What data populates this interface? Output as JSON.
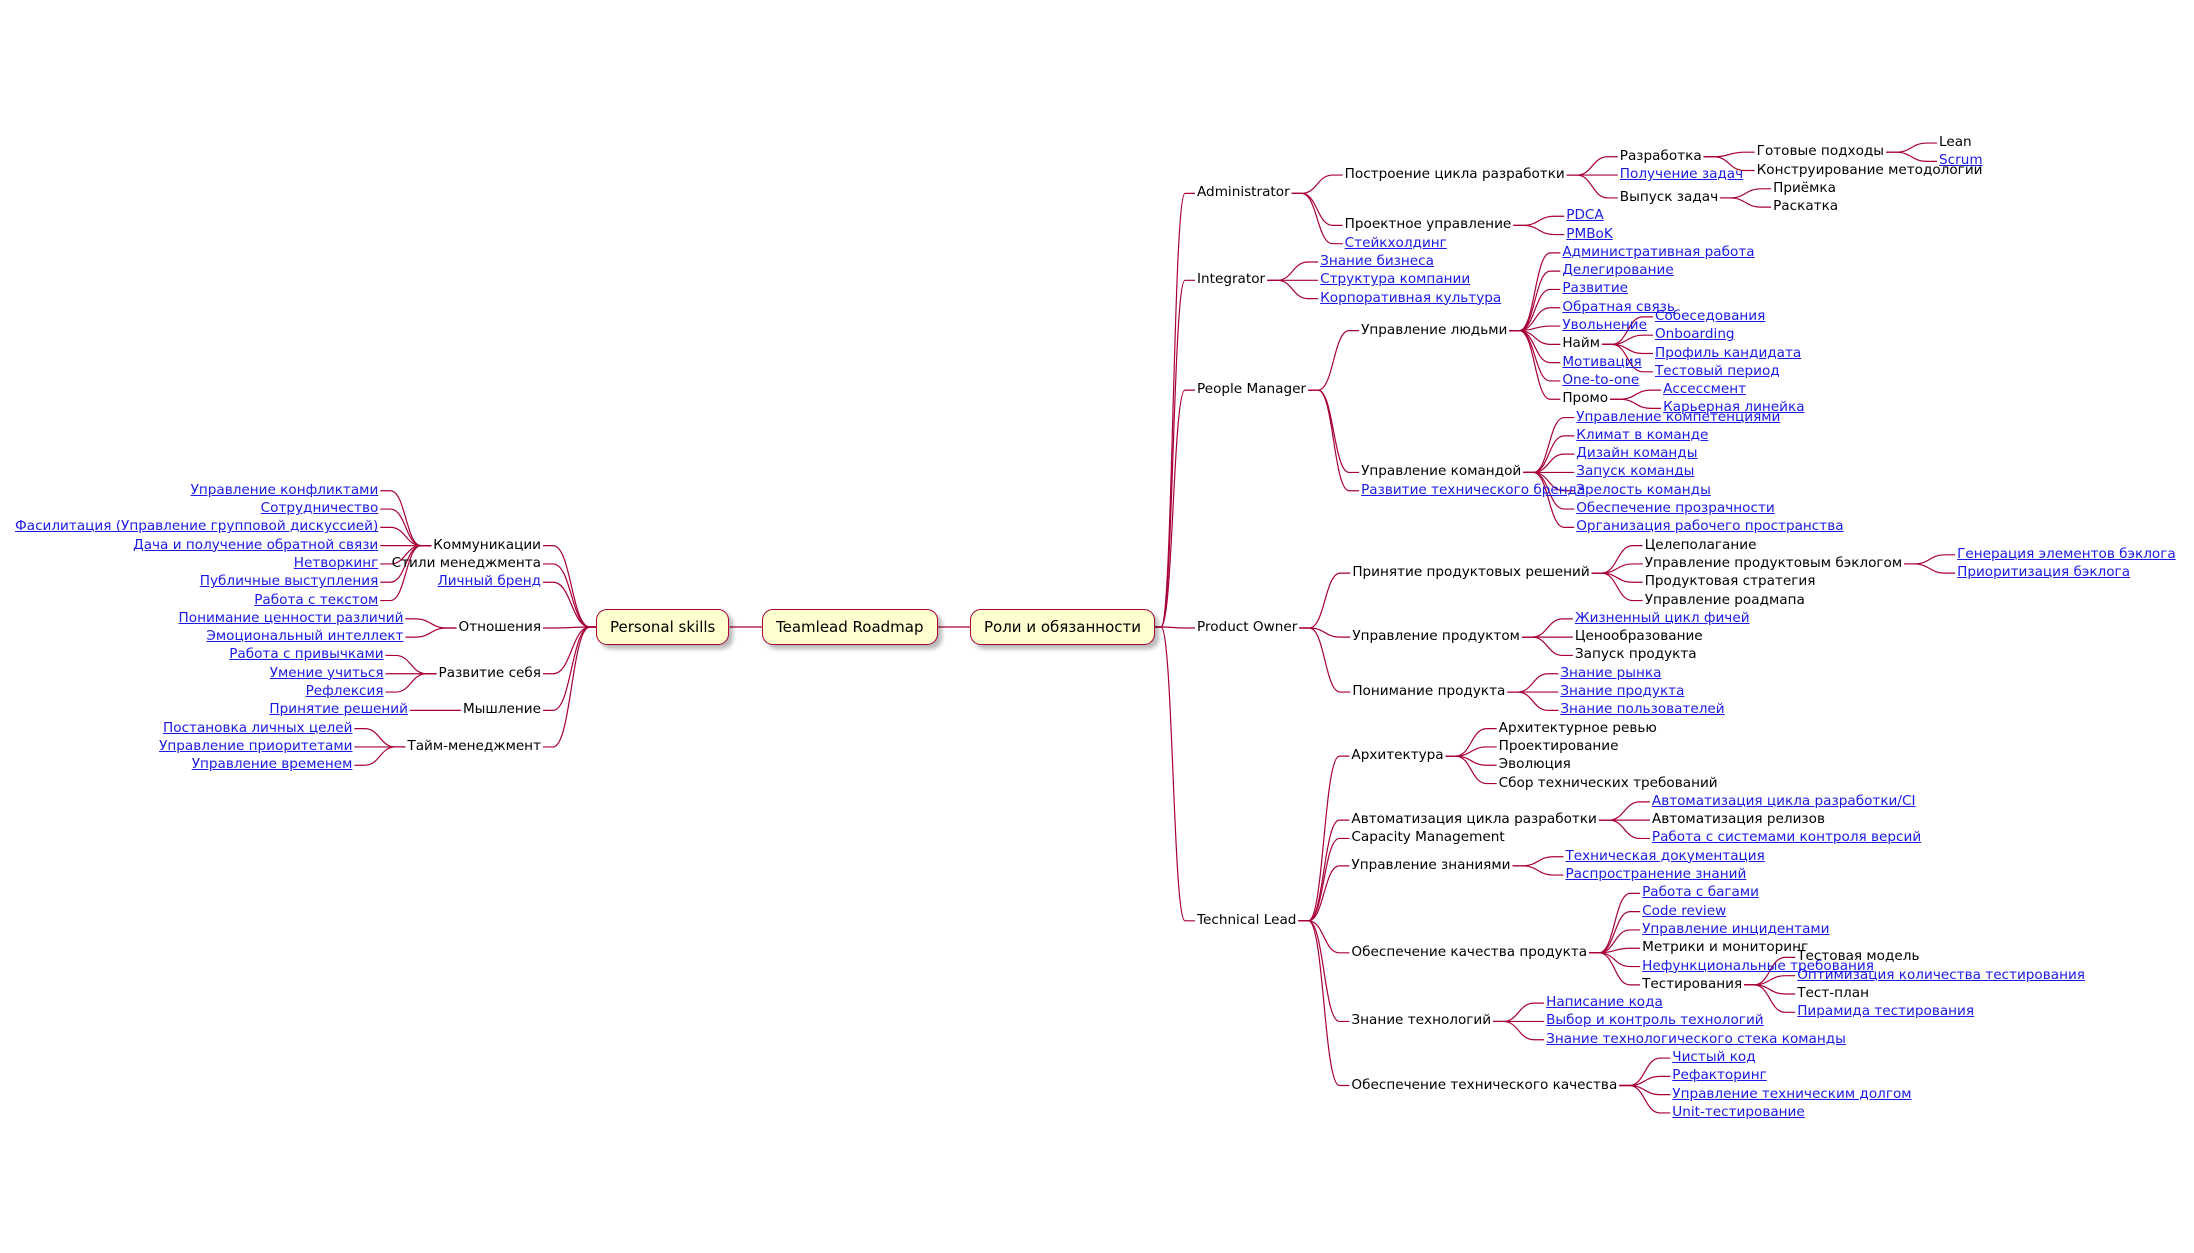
{
  "diagram": {
    "title": "Teamlead Roadmap",
    "colors": {
      "line": "#a80036",
      "box_fill": "#fefece",
      "link": "#1a1ae6",
      "text": "#000000"
    },
    "root": {
      "label": "Teamlead Roadmap"
    },
    "right": {
      "label": "Роли и обязанности",
      "children": [
        {
          "label": "Administrator",
          "children": [
            {
              "label": "Построение цикла разработки",
              "children": [
                {
                  "label": "Разработка",
                  "children": [
                    {
                      "label": "Готовые подходы",
                      "children": [
                        {
                          "label": "Lean"
                        },
                        {
                          "label": "Scrum",
                          "link": true
                        }
                      ]
                    },
                    {
                      "label": "Конструирование методологии"
                    }
                  ]
                },
                {
                  "label": "Получение задач",
                  "link": true
                },
                {
                  "label": "Выпуск задач",
                  "children": [
                    {
                      "label": "Приёмка"
                    },
                    {
                      "label": "Раскатка"
                    }
                  ]
                }
              ]
            },
            {
              "label": "Проектное управление",
              "children": [
                {
                  "label": "PDCA",
                  "link": true
                },
                {
                  "label": "PMBoK",
                  "link": true
                }
              ]
            },
            {
              "label": "Стейкхолдинг",
              "link": true
            }
          ]
        },
        {
          "label": "Integrator",
          "children": [
            {
              "label": "Знание бизнеса",
              "link": true
            },
            {
              "label": "Структура компании",
              "link": true
            },
            {
              "label": "Корпоративная культура",
              "link": true
            }
          ]
        },
        {
          "label": "People Manager",
          "children": [
            {
              "label": "Управление людьми",
              "children": [
                {
                  "label": "Административная работа",
                  "link": true
                },
                {
                  "label": "Делегирование",
                  "link": true
                },
                {
                  "label": "Развитие",
                  "link": true
                },
                {
                  "label": "Обратная связь",
                  "link": true
                },
                {
                  "label": "Увольнение",
                  "link": true
                },
                {
                  "label": "Найм",
                  "children": [
                    {
                      "label": "Собеседования",
                      "link": true
                    },
                    {
                      "label": "Onboarding",
                      "link": true
                    },
                    {
                      "label": "Профиль кандидата",
                      "link": true
                    },
                    {
                      "label": "Тестовый период",
                      "link": true
                    }
                  ]
                },
                {
                  "label": "Мотивация",
                  "link": true
                },
                {
                  "label": "One-to-one",
                  "link": true
                },
                {
                  "label": "Промо",
                  "children": [
                    {
                      "label": "Ассессмент",
                      "link": true
                    },
                    {
                      "label": "Карьерная линейка",
                      "link": true
                    }
                  ]
                }
              ]
            },
            {
              "label": "Управление командой",
              "children": [
                {
                  "label": "Управление компетенциями",
                  "link": true
                },
                {
                  "label": "Климат в команде",
                  "link": true
                },
                {
                  "label": "Дизайн команды",
                  "link": true
                },
                {
                  "label": "Запуск команды",
                  "link": true
                },
                {
                  "label": "Зрелость команды",
                  "link": true
                },
                {
                  "label": "Обеспечение прозрачности",
                  "link": true
                },
                {
                  "label": "Организация рабочего пространства",
                  "link": true
                }
              ]
            },
            {
              "label": "Развитие технического бренда",
              "link": true
            }
          ]
        },
        {
          "label": "Product Owner",
          "children": [
            {
              "label": "Принятие продуктовых решений",
              "children": [
                {
                  "label": "Целеполагание"
                },
                {
                  "label": "Управление продуктовым бэклогом",
                  "children": [
                    {
                      "label": "Генерация элементов бэклога",
                      "link": true
                    },
                    {
                      "label": "Приоритизация бэклога",
                      "link": true
                    }
                  ]
                },
                {
                  "label": "Продуктовая стратегия"
                },
                {
                  "label": "Управление роадмапа"
                }
              ]
            },
            {
              "label": "Управление продуктом",
              "children": [
                {
                  "label": "Жизненный цикл фичей",
                  "link": true
                },
                {
                  "label": "Ценообразование"
                },
                {
                  "label": "Запуск продукта"
                }
              ]
            },
            {
              "label": "Понимание продукта",
              "children": [
                {
                  "label": "Знание рынка",
                  "link": true
                },
                {
                  "label": "Знание продукта",
                  "link": true
                },
                {
                  "label": "Знание пользователей",
                  "link": true
                }
              ]
            }
          ]
        },
        {
          "label": "Technical Lead",
          "children": [
            {
              "label": "Архитектура",
              "children": [
                {
                  "label": "Архитектурное ревью"
                },
                {
                  "label": "Проектирование"
                },
                {
                  "label": "Эволюция"
                },
                {
                  "label": "Сбор технических требований"
                }
              ]
            },
            {
              "label": "Автоматизация цикла разработки",
              "children": [
                {
                  "label": "Автоматизация цикла разработки/CI",
                  "link": true
                },
                {
                  "label": "Автоматизация релизов"
                },
                {
                  "label": "Работа с системами контроля версий",
                  "link": true
                }
              ]
            },
            {
              "label": "Capacity Management"
            },
            {
              "label": "Управление знаниями",
              "children": [
                {
                  "label": "Техническая документация",
                  "link": true
                },
                {
                  "label": "Распространение знаний",
                  "link": true
                }
              ]
            },
            {
              "label": "Обеспечение качества продукта",
              "children": [
                {
                  "label": "Работа с багами",
                  "link": true
                },
                {
                  "label": "Code review",
                  "link": true
                },
                {
                  "label": "Управление инцидентами",
                  "link": true
                },
                {
                  "label": "Метрики и мониторинг"
                },
                {
                  "label": "Нефункциональные требования",
                  "link": true
                },
                {
                  "label": "Тестирования",
                  "children": [
                    {
                      "label": "Тестовая модель"
                    },
                    {
                      "label": "Оптимизация количества тестирования",
                      "link": true
                    },
                    {
                      "label": "Тест-план"
                    },
                    {
                      "label": "Пирамида тестирования",
                      "link": true
                    }
                  ]
                }
              ]
            },
            {
              "label": "Знание технологий",
              "children": [
                {
                  "label": "Написание кода",
                  "link": true
                },
                {
                  "label": "Выбор и контроль технологий",
                  "link": true
                },
                {
                  "label": "Знание технологического стека команды",
                  "link": true
                }
              ]
            },
            {
              "label": "Обеспечение технического качества",
              "children": [
                {
                  "label": "Чистый код",
                  "link": true
                },
                {
                  "label": "Рефакторинг",
                  "link": true
                },
                {
                  "label": "Управление техническим долгом",
                  "link": true
                },
                {
                  "label": "Unit-тестирование",
                  "link": true
                }
              ]
            }
          ]
        }
      ]
    },
    "left": {
      "label": "Personal skills",
      "children": [
        {
          "label": "Коммуникации",
          "children": [
            {
              "label": "Управление конфликтами",
              "link": true
            },
            {
              "label": "Сотрудничество",
              "link": true
            },
            {
              "label": "Фасилитация (Управление групповой дискуссией)",
              "link": true
            },
            {
              "label": "Дача и получение обратной связи",
              "link": true
            },
            {
              "label": "Нетворкинг",
              "link": true
            },
            {
              "label": "Публичные выступления",
              "link": true
            },
            {
              "label": "Работа с текстом",
              "link": true
            }
          ]
        },
        {
          "label": "Стили менеджмента"
        },
        {
          "label": "Личный бренд",
          "link": true
        },
        {
          "label": "Отношения",
          "children": [
            {
              "label": "Понимание ценности различий",
              "link": true
            },
            {
              "label": "Эмоциональный интеллект",
              "link": true
            }
          ]
        },
        {
          "label": "Развитие себя",
          "children": [
            {
              "label": "Работа с привычками",
              "link": true
            },
            {
              "label": "Умение учиться",
              "link": true
            },
            {
              "label": "Рефлексия",
              "link": true
            }
          ]
        },
        {
          "label": "Мышление",
          "children": [
            {
              "label": "Принятие решений",
              "link": true
            }
          ]
        },
        {
          "label": "Тайм-менеджмент",
          "children": [
            {
              "label": "Постановка личных целей",
              "link": true
            },
            {
              "label": "Управление приоритетами",
              "link": true
            },
            {
              "label": "Управление временем",
              "link": true
            }
          ]
        }
      ]
    }
  }
}
